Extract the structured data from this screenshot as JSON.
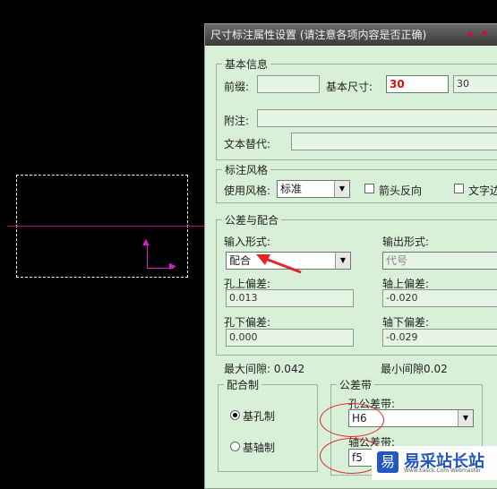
{
  "dialog": {
    "title": "尺寸标注属性设置 (请注意各项内容是否正确)"
  },
  "basic": {
    "legend": "基本信息",
    "prefix_label": "前缀:",
    "prefix_value": "",
    "basic_size_label": "基本尺寸:",
    "basic_size_value": "30",
    "basic_size_value2": "30",
    "note_label": "附注:",
    "note_value": "",
    "text_replace_label": "文本替代:",
    "text_replace_value": ""
  },
  "style": {
    "legend": "标注风格",
    "use_style_label": "使用风格:",
    "use_style_value": "标准",
    "arrow_reverse_label": "箭头反向",
    "text_side_label": "文字边"
  },
  "tolerance": {
    "legend": "公差与配合",
    "input_form_label": "输入形式:",
    "input_form_value": "配合",
    "output_form_label": "输出形式:",
    "output_form_value": "代号",
    "hole_upper_label": "孔上偏差:",
    "hole_upper_value": "0.013",
    "shaft_upper_label": "轴上偏差:",
    "shaft_upper_value": "-0.020",
    "hole_lower_label": "孔下偏差:",
    "hole_lower_value": "0.000",
    "shaft_lower_label": "轴下偏差:",
    "shaft_lower_value": "-0.029",
    "max_clearance_label": "最大间隙: 0.042",
    "min_clearance_label": "最小间隙0.02"
  },
  "fit_system": {
    "legend": "配合制",
    "hole_basis_label": "基孔制",
    "shaft_basis_label": "基轴制",
    "selected": "hole_basis"
  },
  "tolerance_zone": {
    "legend": "公差带",
    "hole_zone_label": "孔公差带:",
    "hole_zone_value": "H6",
    "shaft_zone_label": "轴公差带:",
    "shaft_zone_value": "f5"
  },
  "watermark": {
    "title": "易采站长站",
    "sub": "Www.Easck.Com Webmaster"
  },
  "colors": {
    "dialog_bg": "#d8f0d8",
    "annotation": "#e0282a",
    "cad_line": "#c0106a",
    "ucs": "#d020d0"
  }
}
